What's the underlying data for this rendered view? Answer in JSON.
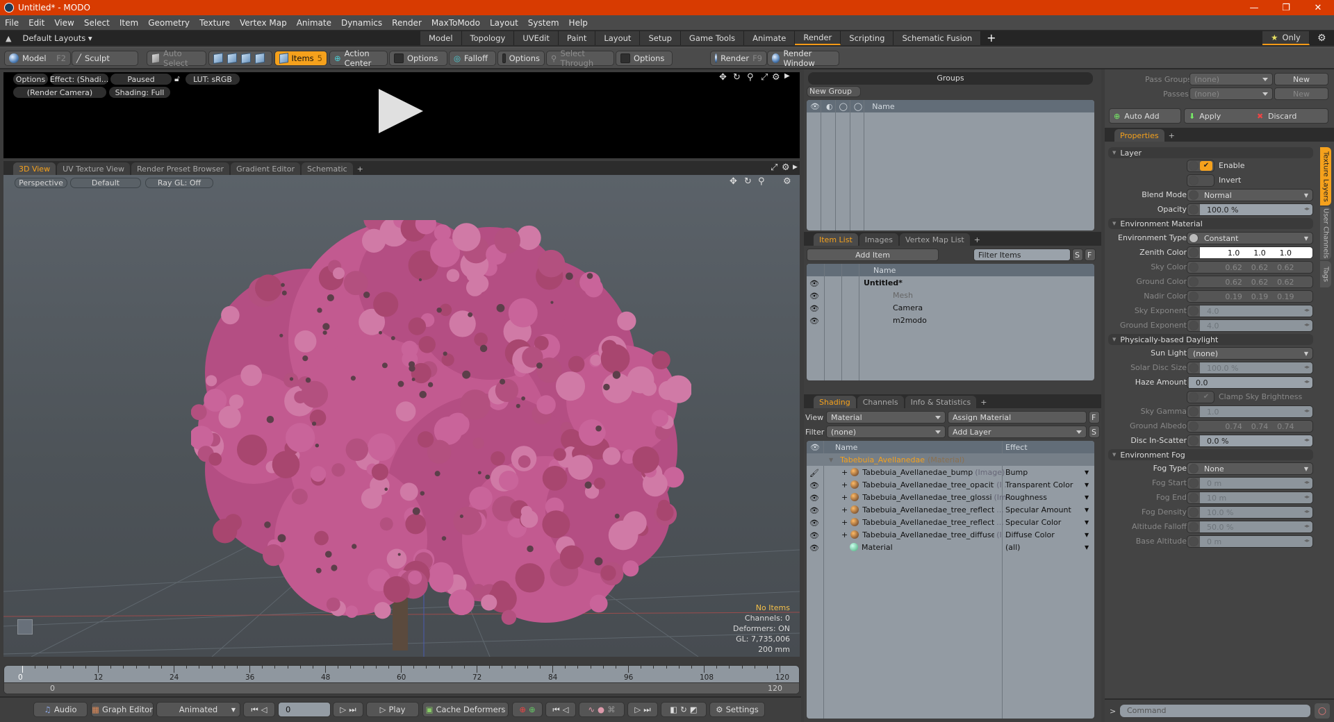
{
  "window": {
    "title": "Untitled* - MODO",
    "minimize": "—",
    "maximize": "❐",
    "close": "✕"
  },
  "menu": [
    "File",
    "Edit",
    "View",
    "Select",
    "Item",
    "Geometry",
    "Texture",
    "Vertex Map",
    "Animate",
    "Dynamics",
    "Render",
    "MaxToModo",
    "Layout",
    "System",
    "Help"
  ],
  "layoutbar": {
    "layouts_label": "Default Layouts ▾",
    "tabs": [
      "Model",
      "Topology",
      "UVEdit",
      "Paint",
      "Layout",
      "Setup",
      "Game Tools",
      "Animate",
      "Render",
      "Scripting",
      "Schematic Fusion"
    ],
    "active_tab": "Render",
    "add": "+",
    "only_label": "Only"
  },
  "toolbar": {
    "model": "Model",
    "model_key": "F2",
    "sculpt": "Sculpt",
    "auto_select": "Auto Select",
    "items": "Items",
    "items_count": "5",
    "action_center": "Action Center",
    "options1": "Options",
    "falloff": "Falloff",
    "options2": "Options",
    "select_through": "Select Through",
    "options3": "Options",
    "render": "Render",
    "render_key": "F9",
    "render_window": "Render Window"
  },
  "render_view": {
    "options": "Options",
    "effect": "Effect: (Shadi...",
    "paused": "Paused",
    "lut": "LUT: sRGB",
    "camera": "(Render Camera)",
    "shading": "Shading: Full"
  },
  "viewport": {
    "tabs": [
      "3D View",
      "UV Texture View",
      "Render Preset Browser",
      "Gradient Editor",
      "Schematic"
    ],
    "active_tab": "3D View",
    "add": "+",
    "perspective": "Perspective",
    "default": "Default",
    "raygl": "Ray GL: Off",
    "stats": {
      "items": "No Items",
      "channels": "Channels: 0",
      "deformers": "Deformers: ON",
      "gl": "GL: 7,735,006",
      "scale": "200 mm"
    }
  },
  "timeline": {
    "ticks": [
      "0",
      "12",
      "24",
      "36",
      "48",
      "60",
      "72",
      "84",
      "96",
      "108",
      "120"
    ],
    "range_start": "0",
    "range_end": "120",
    "current_frame": "0"
  },
  "transport": {
    "audio": "Audio",
    "graph_editor": "Graph Editor",
    "animated": "Animated",
    "frame": "0",
    "play": "Play",
    "cache_deformers": "Cache Deformers",
    "settings": "Settings"
  },
  "groups": {
    "title": "Groups",
    "new_group": "New Group",
    "name_col": "Name"
  },
  "item_list": {
    "tabs": [
      "Item List",
      "Images",
      "Vertex Map List"
    ],
    "active_tab": "Item List",
    "add_item": "Add Item",
    "filter_placeholder": "Filter Items",
    "s": "S",
    "f": "F",
    "name_col": "Name",
    "items": [
      {
        "name": "Untitled*",
        "bold": true
      },
      {
        "name": "Mesh",
        "dim": true
      },
      {
        "name": "Camera"
      },
      {
        "name": "m2modo"
      }
    ]
  },
  "shading": {
    "tabs": [
      "Shading",
      "Channels",
      "Info & Statistics"
    ],
    "active_tab": "Shading",
    "view_label": "View",
    "view_value": "Material",
    "assign_material": "Assign Material",
    "filter_label": "Filter",
    "filter_value": "(none)",
    "add_layer": "Add Layer",
    "f": "F",
    "s": "S",
    "name_col": "Name",
    "effect_col": "Effect",
    "material": {
      "name": "Tabebuia_Avellanedae",
      "type": "(Material)"
    },
    "layers": [
      {
        "name": "Tabebuia_Avellanedae_bump",
        "type": "(Image)",
        "effect": "Bump"
      },
      {
        "name": "Tabebuia_Avellanedae_tree_opacity",
        "type": "(I ...",
        "effect": "Transparent Color"
      },
      {
        "name": "Tabebuia_Avellanedae_tree_glossi",
        "type": "(Im ...",
        "effect": "Roughness"
      },
      {
        "name": "Tabebuia_Avellanedae_tree_reflection",
        "type": "...",
        "effect": "Specular Amount"
      },
      {
        "name": "Tabebuia_Avellanedae_tree_reflection",
        "type": "...",
        "effect": "Specular Color"
      },
      {
        "name": "Tabebuia_Avellanedae_tree_diffuse",
        "type": "(I ...",
        "effect": "Diffuse Color"
      },
      {
        "name": "Material",
        "type": "",
        "effect": "(all)"
      }
    ]
  },
  "passes": {
    "pass_groups_label": "Pass Groups",
    "pass_groups_value": "(none)",
    "passes_label": "Passes",
    "passes_value": "(none)",
    "new": "New",
    "auto_add": "Auto Add",
    "apply": "Apply",
    "discard": "Discard"
  },
  "properties": {
    "tab": "Properties",
    "add": "+",
    "side_tabs": [
      "Texture Layers",
      "User Channels",
      "Tags"
    ],
    "sections": {
      "layer": "Layer",
      "env_material": "Environment Material",
      "daylight": "Physically-based Daylight",
      "fog": "Environment Fog"
    },
    "enable": "Enable",
    "invert": "Invert",
    "blend_mode": "Blend Mode",
    "blend_mode_value": "Normal",
    "opacity": "Opacity",
    "opacity_value": "100.0 %",
    "env_type": "Environment Type",
    "env_type_value": "Constant",
    "zenith": "Zenith Color",
    "zenith_value": [
      "1.0",
      "1.0",
      "1.0"
    ],
    "sky": "Sky Color",
    "sky_value": [
      "0.62",
      "0.62",
      "0.62"
    ],
    "ground": "Ground Color",
    "ground_value": [
      "0.62",
      "0.62",
      "0.62"
    ],
    "nadir": "Nadir Color",
    "nadir_value": [
      "0.19",
      "0.19",
      "0.19"
    ],
    "sky_exp": "Sky Exponent",
    "sky_exp_value": "4.0",
    "ground_exp": "Ground Exponent",
    "ground_exp_value": "4.0",
    "sun_light": "Sun Light",
    "sun_light_value": "(none)",
    "solar_disc": "Solar Disc Size",
    "solar_disc_value": "100.0 %",
    "haze": "Haze Amount",
    "haze_value": "0.0",
    "clamp": "Clamp Sky Brightness",
    "sky_gamma": "Sky Gamma",
    "sky_gamma_value": "1.0",
    "albedo": "Ground Albedo",
    "albedo_value": [
      "0.74",
      "0.74",
      "0.74"
    ],
    "disc_scatter": "Disc In-Scatter",
    "disc_scatter_value": "0.0 %",
    "fog_type": "Fog Type",
    "fog_type_value": "None",
    "fog_start": "Fog Start",
    "fog_start_value": "0 m",
    "fog_end": "Fog End",
    "fog_end_value": "10 m",
    "fog_density": "Fog Density",
    "fog_density_value": "10.0 %",
    "alt_falloff": "Altitude Falloff",
    "alt_falloff_value": "50.0 %",
    "base_alt": "Base Altitude",
    "base_alt_value": "0 m"
  },
  "command": {
    "prompt": ">",
    "placeholder": "Command"
  },
  "colors": {
    "accent": "#f5a11c",
    "title_bar": "#d83b01",
    "foliage": "#c0588f"
  }
}
